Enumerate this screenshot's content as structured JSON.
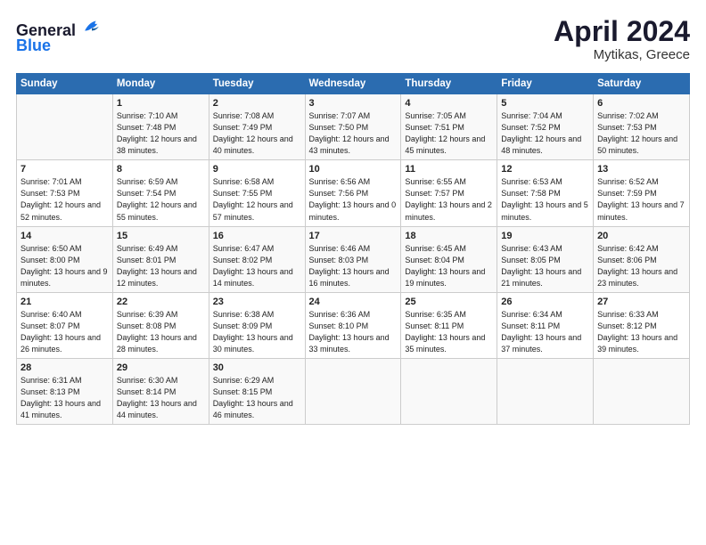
{
  "header": {
    "logo_line1": "General",
    "logo_line2": "Blue",
    "month": "April 2024",
    "location": "Mytikas, Greece"
  },
  "weekdays": [
    "Sunday",
    "Monday",
    "Tuesday",
    "Wednesday",
    "Thursday",
    "Friday",
    "Saturday"
  ],
  "weeks": [
    [
      {
        "day": "",
        "info": ""
      },
      {
        "day": "1",
        "info": "Sunrise: 7:10 AM\nSunset: 7:48 PM\nDaylight: 12 hours\nand 38 minutes."
      },
      {
        "day": "2",
        "info": "Sunrise: 7:08 AM\nSunset: 7:49 PM\nDaylight: 12 hours\nand 40 minutes."
      },
      {
        "day": "3",
        "info": "Sunrise: 7:07 AM\nSunset: 7:50 PM\nDaylight: 12 hours\nand 43 minutes."
      },
      {
        "day": "4",
        "info": "Sunrise: 7:05 AM\nSunset: 7:51 PM\nDaylight: 12 hours\nand 45 minutes."
      },
      {
        "day": "5",
        "info": "Sunrise: 7:04 AM\nSunset: 7:52 PM\nDaylight: 12 hours\nand 48 minutes."
      },
      {
        "day": "6",
        "info": "Sunrise: 7:02 AM\nSunset: 7:53 PM\nDaylight: 12 hours\nand 50 minutes."
      }
    ],
    [
      {
        "day": "7",
        "info": "Sunrise: 7:01 AM\nSunset: 7:53 PM\nDaylight: 12 hours\nand 52 minutes."
      },
      {
        "day": "8",
        "info": "Sunrise: 6:59 AM\nSunset: 7:54 PM\nDaylight: 12 hours\nand 55 minutes."
      },
      {
        "day": "9",
        "info": "Sunrise: 6:58 AM\nSunset: 7:55 PM\nDaylight: 12 hours\nand 57 minutes."
      },
      {
        "day": "10",
        "info": "Sunrise: 6:56 AM\nSunset: 7:56 PM\nDaylight: 13 hours\nand 0 minutes."
      },
      {
        "day": "11",
        "info": "Sunrise: 6:55 AM\nSunset: 7:57 PM\nDaylight: 13 hours\nand 2 minutes."
      },
      {
        "day": "12",
        "info": "Sunrise: 6:53 AM\nSunset: 7:58 PM\nDaylight: 13 hours\nand 5 minutes."
      },
      {
        "day": "13",
        "info": "Sunrise: 6:52 AM\nSunset: 7:59 PM\nDaylight: 13 hours\nand 7 minutes."
      }
    ],
    [
      {
        "day": "14",
        "info": "Sunrise: 6:50 AM\nSunset: 8:00 PM\nDaylight: 13 hours\nand 9 minutes."
      },
      {
        "day": "15",
        "info": "Sunrise: 6:49 AM\nSunset: 8:01 PM\nDaylight: 13 hours\nand 12 minutes."
      },
      {
        "day": "16",
        "info": "Sunrise: 6:47 AM\nSunset: 8:02 PM\nDaylight: 13 hours\nand 14 minutes."
      },
      {
        "day": "17",
        "info": "Sunrise: 6:46 AM\nSunset: 8:03 PM\nDaylight: 13 hours\nand 16 minutes."
      },
      {
        "day": "18",
        "info": "Sunrise: 6:45 AM\nSunset: 8:04 PM\nDaylight: 13 hours\nand 19 minutes."
      },
      {
        "day": "19",
        "info": "Sunrise: 6:43 AM\nSunset: 8:05 PM\nDaylight: 13 hours\nand 21 minutes."
      },
      {
        "day": "20",
        "info": "Sunrise: 6:42 AM\nSunset: 8:06 PM\nDaylight: 13 hours\nand 23 minutes."
      }
    ],
    [
      {
        "day": "21",
        "info": "Sunrise: 6:40 AM\nSunset: 8:07 PM\nDaylight: 13 hours\nand 26 minutes."
      },
      {
        "day": "22",
        "info": "Sunrise: 6:39 AM\nSunset: 8:08 PM\nDaylight: 13 hours\nand 28 minutes."
      },
      {
        "day": "23",
        "info": "Sunrise: 6:38 AM\nSunset: 8:09 PM\nDaylight: 13 hours\nand 30 minutes."
      },
      {
        "day": "24",
        "info": "Sunrise: 6:36 AM\nSunset: 8:10 PM\nDaylight: 13 hours\nand 33 minutes."
      },
      {
        "day": "25",
        "info": "Sunrise: 6:35 AM\nSunset: 8:11 PM\nDaylight: 13 hours\nand 35 minutes."
      },
      {
        "day": "26",
        "info": "Sunrise: 6:34 AM\nSunset: 8:11 PM\nDaylight: 13 hours\nand 37 minutes."
      },
      {
        "day": "27",
        "info": "Sunrise: 6:33 AM\nSunset: 8:12 PM\nDaylight: 13 hours\nand 39 minutes."
      }
    ],
    [
      {
        "day": "28",
        "info": "Sunrise: 6:31 AM\nSunset: 8:13 PM\nDaylight: 13 hours\nand 41 minutes."
      },
      {
        "day": "29",
        "info": "Sunrise: 6:30 AM\nSunset: 8:14 PM\nDaylight: 13 hours\nand 44 minutes."
      },
      {
        "day": "30",
        "info": "Sunrise: 6:29 AM\nSunset: 8:15 PM\nDaylight: 13 hours\nand 46 minutes."
      },
      {
        "day": "",
        "info": ""
      },
      {
        "day": "",
        "info": ""
      },
      {
        "day": "",
        "info": ""
      },
      {
        "day": "",
        "info": ""
      }
    ]
  ]
}
